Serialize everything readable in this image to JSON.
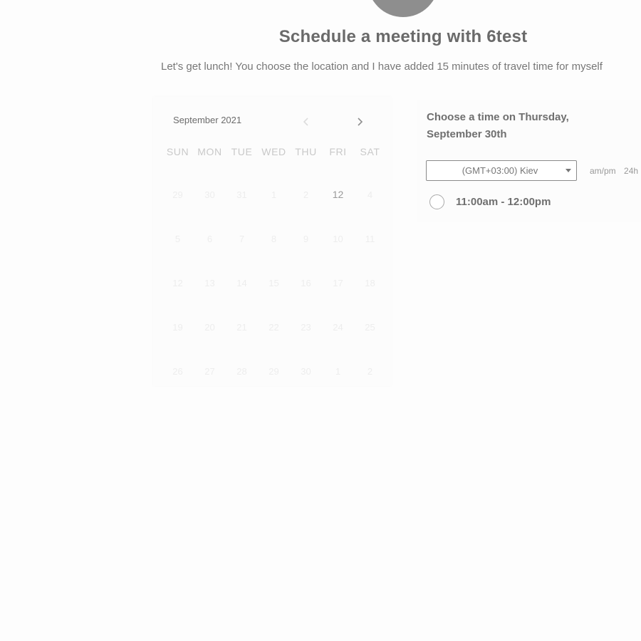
{
  "header": {
    "title": "Schedule a meeting with 6test",
    "description": "Let's get lunch! You choose the location and I have added 15 minutes of travel time for myself"
  },
  "calendar": {
    "month_label": "September 2021",
    "prev_icon": "chevron-left-icon",
    "next_icon": "chevron-right-icon",
    "weekdays": [
      "SUN",
      "MON",
      "TUE",
      "WED",
      "THU",
      "FRI",
      "SAT"
    ],
    "weeks": [
      [
        "29",
        "30",
        "31",
        "1",
        "2",
        "12",
        "4"
      ],
      [
        "5",
        "6",
        "7",
        "8",
        "9",
        "10",
        "11"
      ],
      [
        "12",
        "13",
        "14",
        "15",
        "16",
        "17",
        "18"
      ],
      [
        "19",
        "20",
        "21",
        "22",
        "23",
        "24",
        "25"
      ],
      [
        "26",
        "27",
        "28",
        "29",
        "30",
        "1",
        "2"
      ]
    ],
    "bookable_days": [
      "12"
    ]
  },
  "time_panel": {
    "heading": "Choose a time on Thursday, September 30th",
    "timezone": "(GMT+03:00) Kiev",
    "format_options": [
      "am/pm",
      "24h"
    ],
    "slots": [
      "11:00am - 12:00pm"
    ]
  },
  "colors": {
    "avatar": "#8e8e8e",
    "heading_text": "#6a6a6a",
    "muted_text": "#c9c9c9"
  }
}
